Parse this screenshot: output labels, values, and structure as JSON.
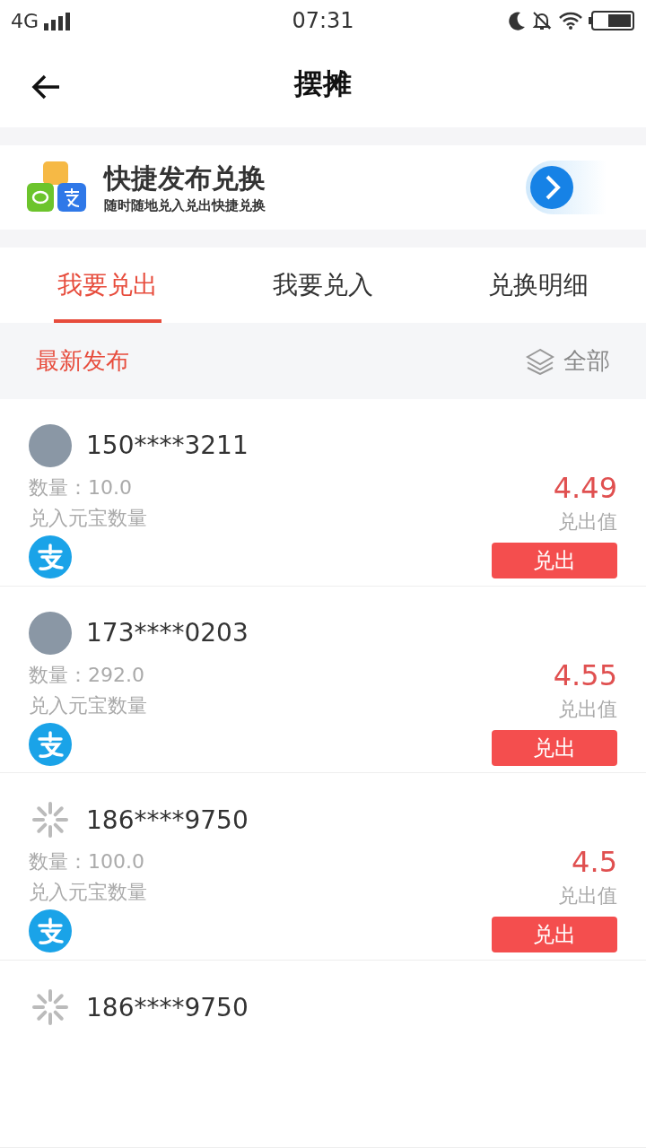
{
  "status_bar": {
    "network": "4G",
    "time": "07:31"
  },
  "header": {
    "title": "摆摊"
  },
  "banner": {
    "title": "快捷发布兑换",
    "subtitle": "随时随地兑入兑出快捷兑换"
  },
  "tabs": [
    {
      "label": "我要兑出",
      "selected": true
    },
    {
      "label": "我要兑入",
      "selected": false
    },
    {
      "label": "兑换明细",
      "selected": false
    }
  ],
  "filter": {
    "label": "最新发布",
    "option": "全部"
  },
  "listings": [
    {
      "kind": "photo",
      "user": "150****3211",
      "quantity": "数量：10.0",
      "quantity_label": "兑入元宝数量",
      "value": "4.49",
      "value_label": "兑出值",
      "action": "兑出"
    },
    {
      "kind": "photo",
      "user": "173****0203",
      "quantity": "数量：292.0",
      "quantity_label": "兑入元宝数量",
      "value": "4.55",
      "value_label": "兑出值",
      "action": "兑出"
    },
    {
      "kind": "loading",
      "user": "186****9750",
      "quantity": "数量：100.0",
      "quantity_label": "兑入元宝数量",
      "value": "4.5",
      "value_label": "兑出值",
      "action": "兑出"
    },
    {
      "kind": "loading",
      "user": "186****9750"
    }
  ]
}
